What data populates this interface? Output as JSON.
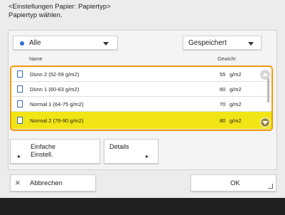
{
  "header": {
    "line1": "<Einstellungen Papier: Papiertyp>",
    "line2": "Papiertyp wählen."
  },
  "filters": {
    "category": "Alle",
    "saved": "Gespeichert"
  },
  "table": {
    "col_name": "Name",
    "col_weight": "Gewicht",
    "rows": [
      {
        "name": "Dünn 2 (52-59 g/m2)",
        "weight": "55",
        "unit": "g/m2",
        "selected": false
      },
      {
        "name": "Dünn 1 (60-63 g/m2)",
        "weight": "60",
        "unit": "g/m2",
        "selected": false
      },
      {
        "name": "Normal 1 (64-75 g/m2)",
        "weight": "70",
        "unit": "g/m2",
        "selected": false
      },
      {
        "name": "Normal 2 (76-90 g/m2)",
        "weight": "80",
        "unit": "g/m2",
        "selected": true
      }
    ]
  },
  "buttons": {
    "simple_line1": "Einfache",
    "simple_line2": "Einstell.",
    "details": "Details",
    "cancel": "Abbrechen",
    "ok": "OK"
  },
  "colors": {
    "selection": "#f2e516",
    "focus_border": "#f29a0d",
    "footer": "#212121"
  }
}
